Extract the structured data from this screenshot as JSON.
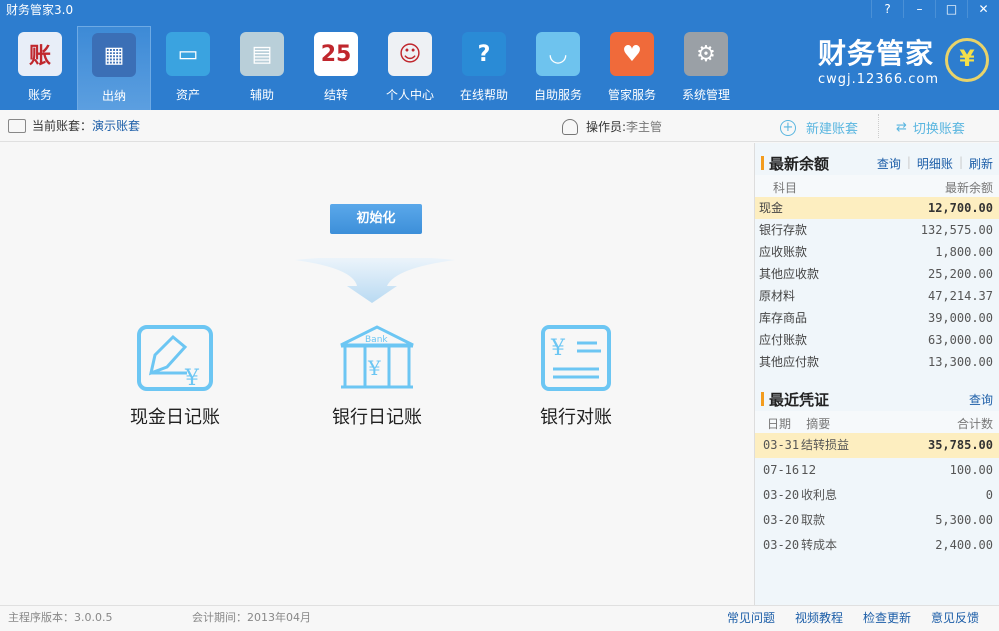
{
  "app": {
    "title": "财务管家3.0",
    "window_buttons": [
      "?",
      "–",
      "□",
      "✕"
    ]
  },
  "toolbar": [
    {
      "label": "账务",
      "icon": "ledger-icon",
      "color": "#e8eef8",
      "glyph": "账"
    },
    {
      "label": "出纳",
      "icon": "calculator-icon",
      "color": "#3b6fb6",
      "glyph": "▦"
    },
    {
      "label": "资产",
      "icon": "monitor-coins-icon",
      "color": "#3aa3e0",
      "glyph": "▭"
    },
    {
      "label": "辅助",
      "icon": "calculator-docs-icon",
      "color": "#b9cfd9",
      "glyph": "▤"
    },
    {
      "label": "结转",
      "icon": "calendar-icon",
      "color": "#ffffff",
      "glyph": "25"
    },
    {
      "label": "个人中心",
      "icon": "user-doc-icon",
      "color": "#eef1f4",
      "glyph": "☺"
    },
    {
      "label": "在线帮助",
      "icon": "globe-help-icon",
      "color": "#2a8bd6",
      "glyph": "?"
    },
    {
      "label": "自助服务",
      "icon": "chat-bubble-icon",
      "color": "#6ec3ee",
      "glyph": "◡"
    },
    {
      "label": "管家服务",
      "icon": "calendar-heart-icon",
      "color": "#f06a3a",
      "glyph": "♥"
    },
    {
      "label": "系统管理",
      "icon": "gear-icon",
      "color": "#9aa0a6",
      "glyph": "⚙"
    }
  ],
  "selected_tool": "出纳",
  "logo": {
    "name": "财务管家",
    "url": "cwgj.12366.com",
    "symbol": "¥"
  },
  "subheader": {
    "account_label": "当前账套：",
    "account_value": "演示账套",
    "operator_label": "操作员:",
    "operator_value": "李主管",
    "new_account": "新建账套",
    "switch_account": "切换账套"
  },
  "main": {
    "init_button": "初始化",
    "features": [
      "现金日记账",
      "银行日记账",
      "银行对账"
    ],
    "bank_text": "Bank",
    "yen": "¥"
  },
  "balance": {
    "title": "最新余额",
    "links": [
      "查询",
      "明细账",
      "刷新"
    ],
    "headers": [
      "科目",
      "最新余额"
    ],
    "rows": [
      [
        "现金",
        "12,700.00"
      ],
      [
        "银行存款",
        "132,575.00"
      ],
      [
        "应收账款",
        "1,800.00"
      ],
      [
        "其他应收款",
        "25,200.00"
      ],
      [
        "原材料",
        "47,214.37"
      ],
      [
        "库存商品",
        "39,000.00"
      ],
      [
        "应付账款",
        "63,000.00"
      ],
      [
        "其他应付款",
        "13,300.00"
      ]
    ]
  },
  "vouchers": {
    "title": "最近凭证",
    "link": "查询",
    "headers": [
      "日期",
      "摘要",
      "合计数"
    ],
    "rows": [
      [
        "03-31",
        "结转损益",
        "35,785.00"
      ],
      [
        "07-16",
        "12",
        "100.00"
      ],
      [
        "03-20",
        "收利息",
        "0"
      ],
      [
        "03-20",
        "取款",
        "5,300.00"
      ],
      [
        "03-20",
        "转成本",
        "2,400.00"
      ]
    ]
  },
  "footer": {
    "version": "主程序版本：3.0.0.5",
    "period": "会计期间：2013年04月",
    "links": [
      "常见问题",
      "视频教程",
      "检查更新",
      "意见反馈"
    ]
  }
}
